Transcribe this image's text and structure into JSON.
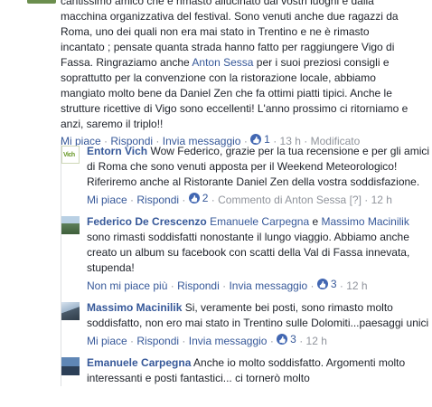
{
  "main_comment": {
    "lines": [
      "cantissimo amico che è rimasto allucinato dai vostri luoghi e dalla",
      "macchina organizzativa del festival. Sono venuti anche due ragazzi da",
      "Roma, uno dei quali non era mai stato in Trentino e ne è rimasto",
      "incantato ; pensate quanta strada hanno fatto per raggiungere Vigo di",
      "Fassa. Ringraziamo anche ",
      "Anton Sessa",
      " per i suoi preziosi consigli e",
      "soprattutto per la convenzione con la ristorazione locale, abbiamo",
      "mangiato molto bene da Daniel Zen che fa ottimi piatti tipici. Anche le",
      "strutture ricettive di Vigo sono eccellenti! L'anno prossimo ci ritorniamo e",
      "anzi, saremo il triplo!!"
    ],
    "actions": {
      "like": "Mi piace",
      "reply": "Rispondi",
      "message": "Invia messaggio",
      "like_count": "1",
      "time": "13 h",
      "edited": "Modificato"
    }
  },
  "replies": [
    {
      "author": "Entorn Vich",
      "avatar_text": "Vich",
      "text": "Wow Federico, grazie per la tua recensione e per gli amici di Roma che sono venuti apposta per il Weekend Meteorologico! Riferiremo anche al Ristorante Daniel Zen della vostra soddisfazione.",
      "actions": {
        "like": "Mi piace",
        "reply": "Rispondi",
        "like_count": "2",
        "comment_of": "Commento di Anton Sessa",
        "help": "[?]",
        "time": "12 h"
      }
    },
    {
      "author": "Federico De Crescenzo",
      "mention1": "Emanuele Carpegna",
      "and": " e ",
      "mention2": "Massimo Macinilik",
      "text": " sono rimasti soddisfatti nonostante il lungo viaggio. Abbiamo anche creato un album su facebook con scatti della Val di Fassa innevata, stupenda!",
      "actions": {
        "like": "Non mi piace più",
        "reply": "Rispondi",
        "message": "Invia messaggio",
        "like_count": "3",
        "time": "12 h"
      }
    },
    {
      "author": "Massimo Macinilik",
      "text": "Si, veramente bei posti, sono rimasto molto soddisfatto, non ero mai stato in Trentino sulle Dolomiti...paesaggi unici",
      "actions": {
        "like": "Mi piace",
        "reply": "Rispondi",
        "message": "Invia messaggio",
        "like_count": "3",
        "time": "12 h"
      }
    },
    {
      "author": "Emanuele Carpegna",
      "text": "Anche io molto soddisfatto. Argomenti molto interessanti e posti fantastici... ci tornerò molto"
    }
  ]
}
